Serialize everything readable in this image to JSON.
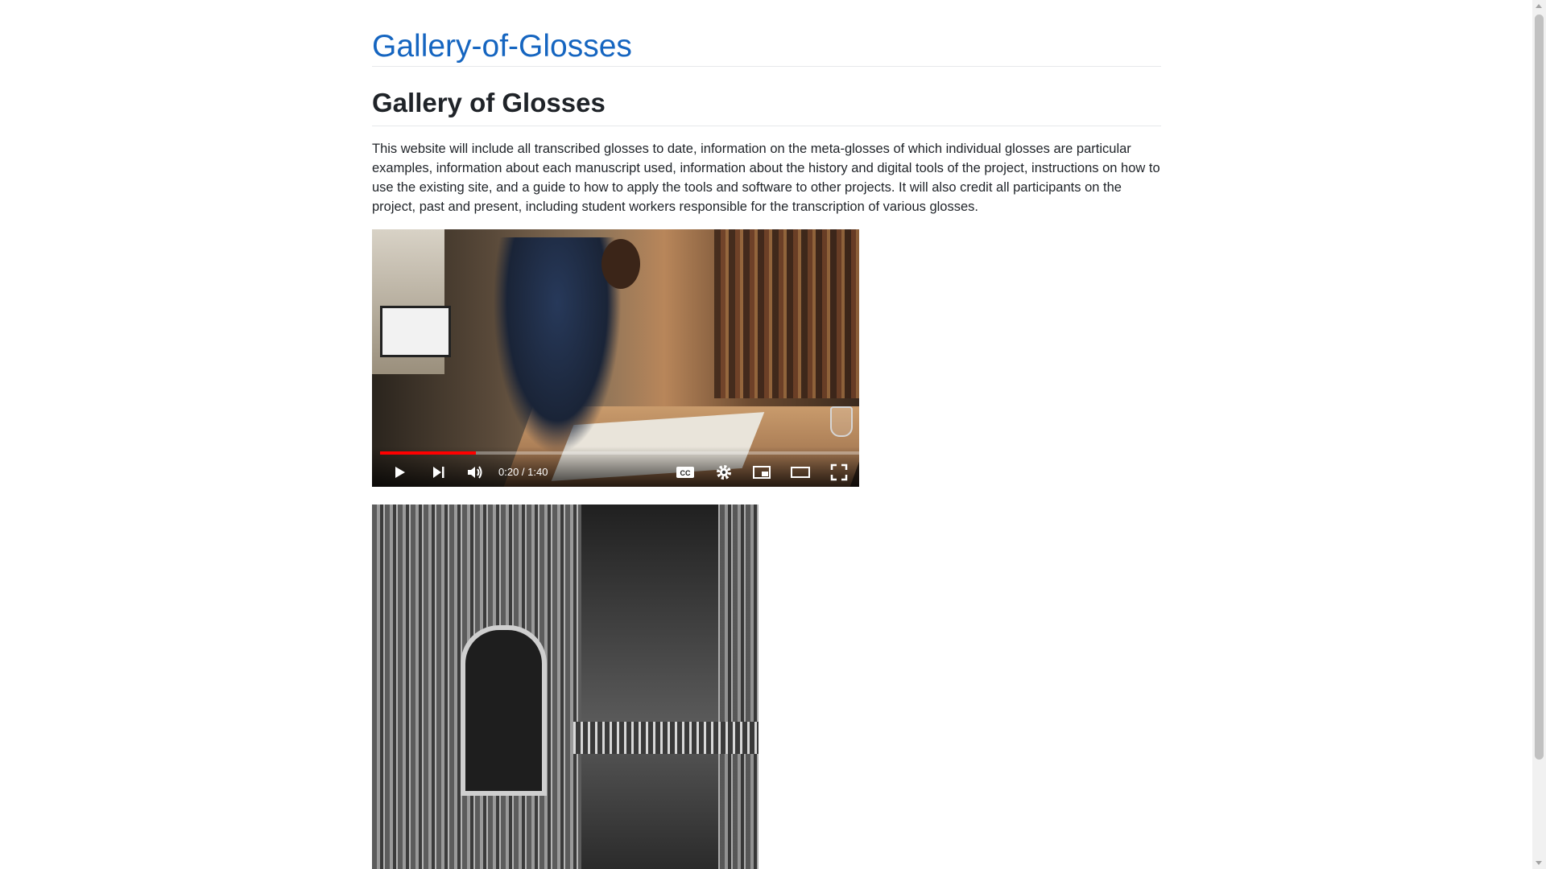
{
  "site": {
    "title": "Gallery-of-Glosses",
    "link_color": "#1565c0"
  },
  "page": {
    "title": "Gallery of Glosses",
    "intro": "This website will include all transcribed glosses to date, information on the meta-glosses of which individual glosses are particular examples, information about each manuscript used, information about the history and digital tools of the project, instructions on how to use the existing site, and a guide to how to apply the tools and software to other projects. It will also credit all participants on the project, past and present, including student workers responsible for the transcription of various glosses."
  },
  "video": {
    "time_display": "0:20 / 1:40",
    "progress_fraction": 0.2,
    "progress_color": "#ff0000",
    "controls": [
      "play-icon",
      "next-icon",
      "volume-icon",
      "cc-icon",
      "settings-icon",
      "miniplayer-icon",
      "theater-icon",
      "fullscreen-icon"
    ]
  }
}
